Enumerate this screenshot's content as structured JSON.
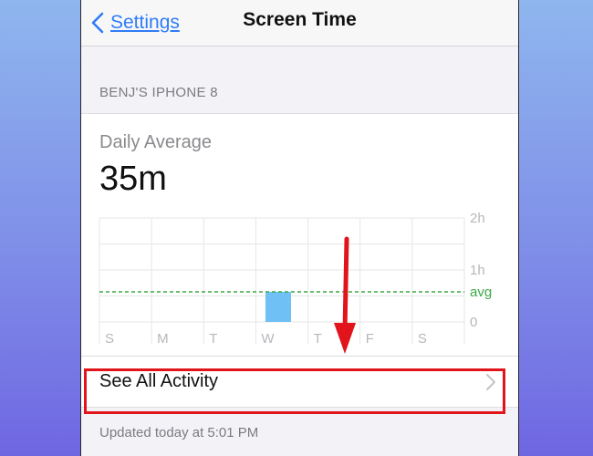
{
  "navbar": {
    "back_label": "Settings",
    "title": "Screen Time"
  },
  "device": {
    "section_header": "BENJ'S IPHONE 8"
  },
  "summary": {
    "label": "Daily Average",
    "value": "35m"
  },
  "chart_data": {
    "type": "bar",
    "categories": [
      "S",
      "M",
      "T",
      "W",
      "T",
      "F",
      "S"
    ],
    "values": [
      0,
      0,
      0,
      0.58,
      0,
      0,
      0
    ],
    "value_units": "hours",
    "ylim": [
      0,
      2
    ],
    "y_ticks": [
      "2h",
      "1h",
      "0"
    ],
    "average": {
      "label": "avg",
      "value": 0.58
    },
    "colors": {
      "bar": "#6ec0f5",
      "avg_line": "#3aa845",
      "grid": "#e6e6e6"
    },
    "grid": true
  },
  "actions": {
    "see_all_label": "See All Activity"
  },
  "footer": {
    "updated_text": "Updated today at 5:01 PM"
  },
  "annotation_colors": {
    "highlight": "#e2141b"
  }
}
